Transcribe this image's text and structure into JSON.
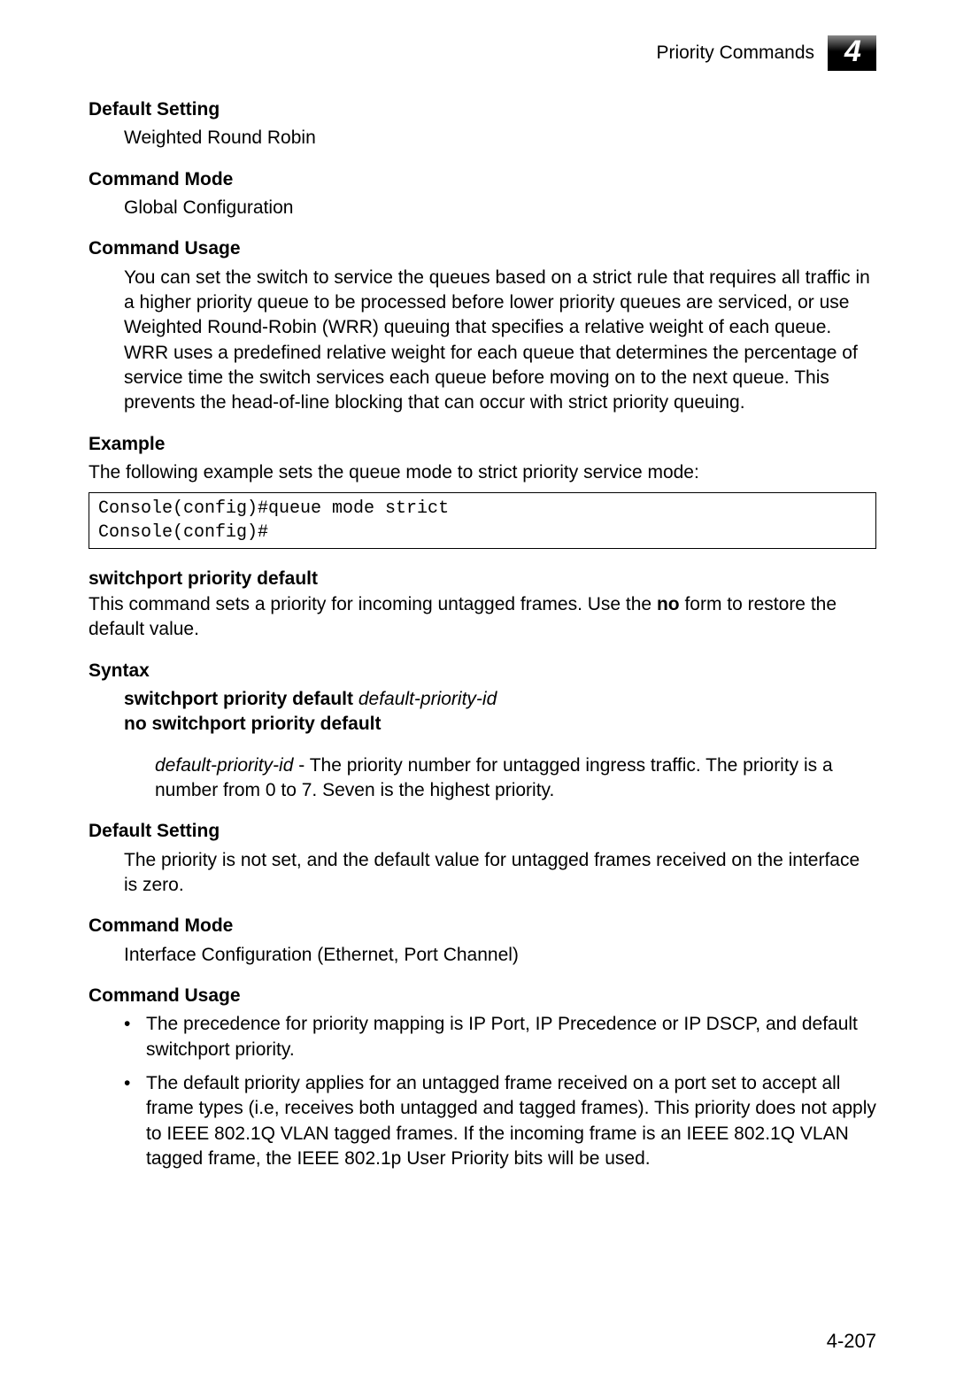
{
  "header": {
    "title": "Priority Commands",
    "chapter": "4"
  },
  "sec1": {
    "heading": "Default Setting",
    "body": "Weighted Round Robin"
  },
  "sec2": {
    "heading": "Command Mode",
    "body": "Global Configuration"
  },
  "sec3": {
    "heading": "Command Usage",
    "body": "You can set the switch to service the queues based on a strict rule that requires all traffic in a higher priority queue to be processed before lower priority queues are serviced, or use Weighted Round-Robin (WRR) queuing that specifies a relative weight of each queue. WRR uses a predefined relative weight for each queue that determines the percentage of service time the switch services each queue before moving on to the next queue. This prevents the head-of-line blocking that can occur with strict priority queuing."
  },
  "sec4": {
    "heading": "Example",
    "intro": "The following example sets the queue mode to strict priority service mode:",
    "code": "Console(config)#queue mode strict\nConsole(config)#"
  },
  "cmd": {
    "name": "switchport priority default",
    "desc_pre": "This command sets a priority for incoming untagged frames. Use the ",
    "desc_bold": "no",
    "desc_post": " form to restore the default value."
  },
  "syntax": {
    "heading": "Syntax",
    "line1_cmd": "switchport priority default",
    "line1_arg": "default-priority-id",
    "line2": "no switchport priority default",
    "param_name": "default-priority-id",
    "param_sep": " - ",
    "param_desc": "The priority number for untagged ingress traffic. The priority is a number from 0 to 7. Seven is the highest priority."
  },
  "sec5": {
    "heading": "Default Setting",
    "body": "The priority is not set, and the default value for untagged frames received on the interface is zero."
  },
  "sec6": {
    "heading": "Command Mode",
    "body": "Interface Configuration (Ethernet, Port Channel)"
  },
  "sec7": {
    "heading": "Command Usage",
    "bullets": [
      "The precedence for priority mapping is IP Port, IP Precedence or IP DSCP, and default switchport priority.",
      "The default priority applies for an untagged frame received on a port set to accept all frame types (i.e, receives both untagged and tagged frames). This priority does not apply to IEEE 802.1Q VLAN tagged frames. If the incoming frame is an IEEE 802.1Q VLAN tagged frame, the IEEE 802.1p User Priority bits will be used."
    ]
  },
  "page_number": "4-207"
}
